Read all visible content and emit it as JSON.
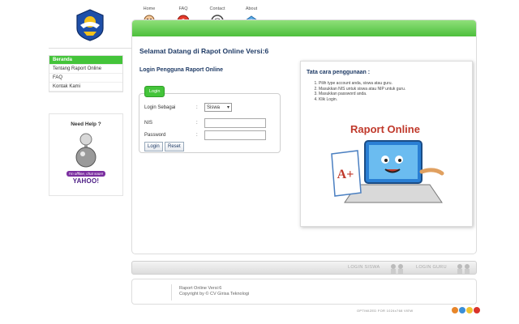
{
  "nav": [
    {
      "label": "Home",
      "icon": "home-icon"
    },
    {
      "label": "FAQ",
      "icon": "faq-icon"
    },
    {
      "label": "Contact",
      "icon": "contact-icon"
    },
    {
      "label": "About",
      "icon": "about-icon"
    }
  ],
  "sidebar": {
    "items": [
      {
        "label": "Beranda",
        "active": true
      },
      {
        "label": "Tentang Raport Online",
        "active": false
      },
      {
        "label": "FAQ",
        "active": false
      },
      {
        "label": "Kontak Kami",
        "active": false
      }
    ],
    "help_title": "Need Help ?",
    "offline_badge": "I'm offline, chat soon!",
    "yahoo_label": "YAHOO!"
  },
  "main": {
    "welcome": "Selamat Datang di Rapot Online Versi:6",
    "login_heading": "Login Pengguna Raport Online",
    "login_legend": "Login",
    "form": {
      "login_as_label": "Login Sebagai",
      "login_as_value": "Siswa",
      "nis_label": "NIS",
      "password_label": "Password",
      "colon": ":"
    },
    "buttons": {
      "login": "Login",
      "reset": "Reset"
    },
    "howto": {
      "title": "Tata cara penggunaan :",
      "steps": [
        "Pilih type account anda, siswa atau guru.",
        "Masukkan NIS untuk siswa atau NIP untuk guru.",
        "Masukkan password anda.",
        "Klik Login."
      ],
      "art_title": "Raport Online",
      "art_grade": "A+"
    }
  },
  "bottom": {
    "login_siswa": "LOGIN SISWA",
    "login_guru": "LOGIN GURU"
  },
  "footer": {
    "line1": "Raport Online Versi:6",
    "line2": "Copyright by © CV Girisa Teknologi",
    "optimized": "OPTIMIZED FOR 1024x768 VIEW"
  },
  "colors": {
    "accent_green": "#44c43a",
    "heading_blue": "#1f3b66"
  }
}
